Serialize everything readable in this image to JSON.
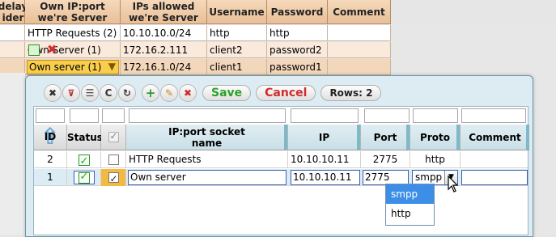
{
  "background_table": {
    "headers": [
      "delay ider",
      "Own IP:port we're Server",
      "IPs allowed we're Server",
      "Username",
      "Password",
      "Comment"
    ],
    "rows": [
      {
        "socket": "HTTP Requests (2)",
        "ips": "10.10.10.0/24",
        "username": "http",
        "password": "http"
      },
      {
        "socket": "Own Server (1)",
        "ips": "172.16.2.111",
        "username": "client2",
        "password": "password2"
      },
      {
        "socket": "Own server (1)",
        "ips": "172.16.1.0/24",
        "username": "client1",
        "password": "password1"
      }
    ]
  },
  "dialog": {
    "toolbar": {
      "save_label": "Save",
      "cancel_label": "Cancel",
      "rows_label": "Rows: 2"
    },
    "columns": {
      "id": "ID",
      "status": "Status",
      "socket": "IP:port socket name",
      "ip": "IP",
      "port": "Port",
      "proto": "Proto",
      "comment": "Comment"
    },
    "rows": [
      {
        "id": "2",
        "socket": "HTTP Requests",
        "ip": "10.10.10.11",
        "port": "2775",
        "proto": "http",
        "comment": ""
      },
      {
        "id": "1",
        "socket": "Own server",
        "ip": "10.10.10.11",
        "port": "2775",
        "proto": "smpp",
        "comment": ""
      }
    ],
    "proto_options": [
      "smpp",
      "http"
    ]
  },
  "colors": {
    "header_bg": "#e9bf98",
    "dialog_bg": "#dcecf2",
    "accent": "#3d8ee6",
    "save": "#2aa12a",
    "cancel": "#d12a2a"
  },
  "icons": [
    "delete-icon",
    "filter-clear-icon",
    "columns-icon",
    "refresh-icon",
    "reload-icon",
    "add-icon",
    "edit-icon",
    "remove-icon"
  ]
}
